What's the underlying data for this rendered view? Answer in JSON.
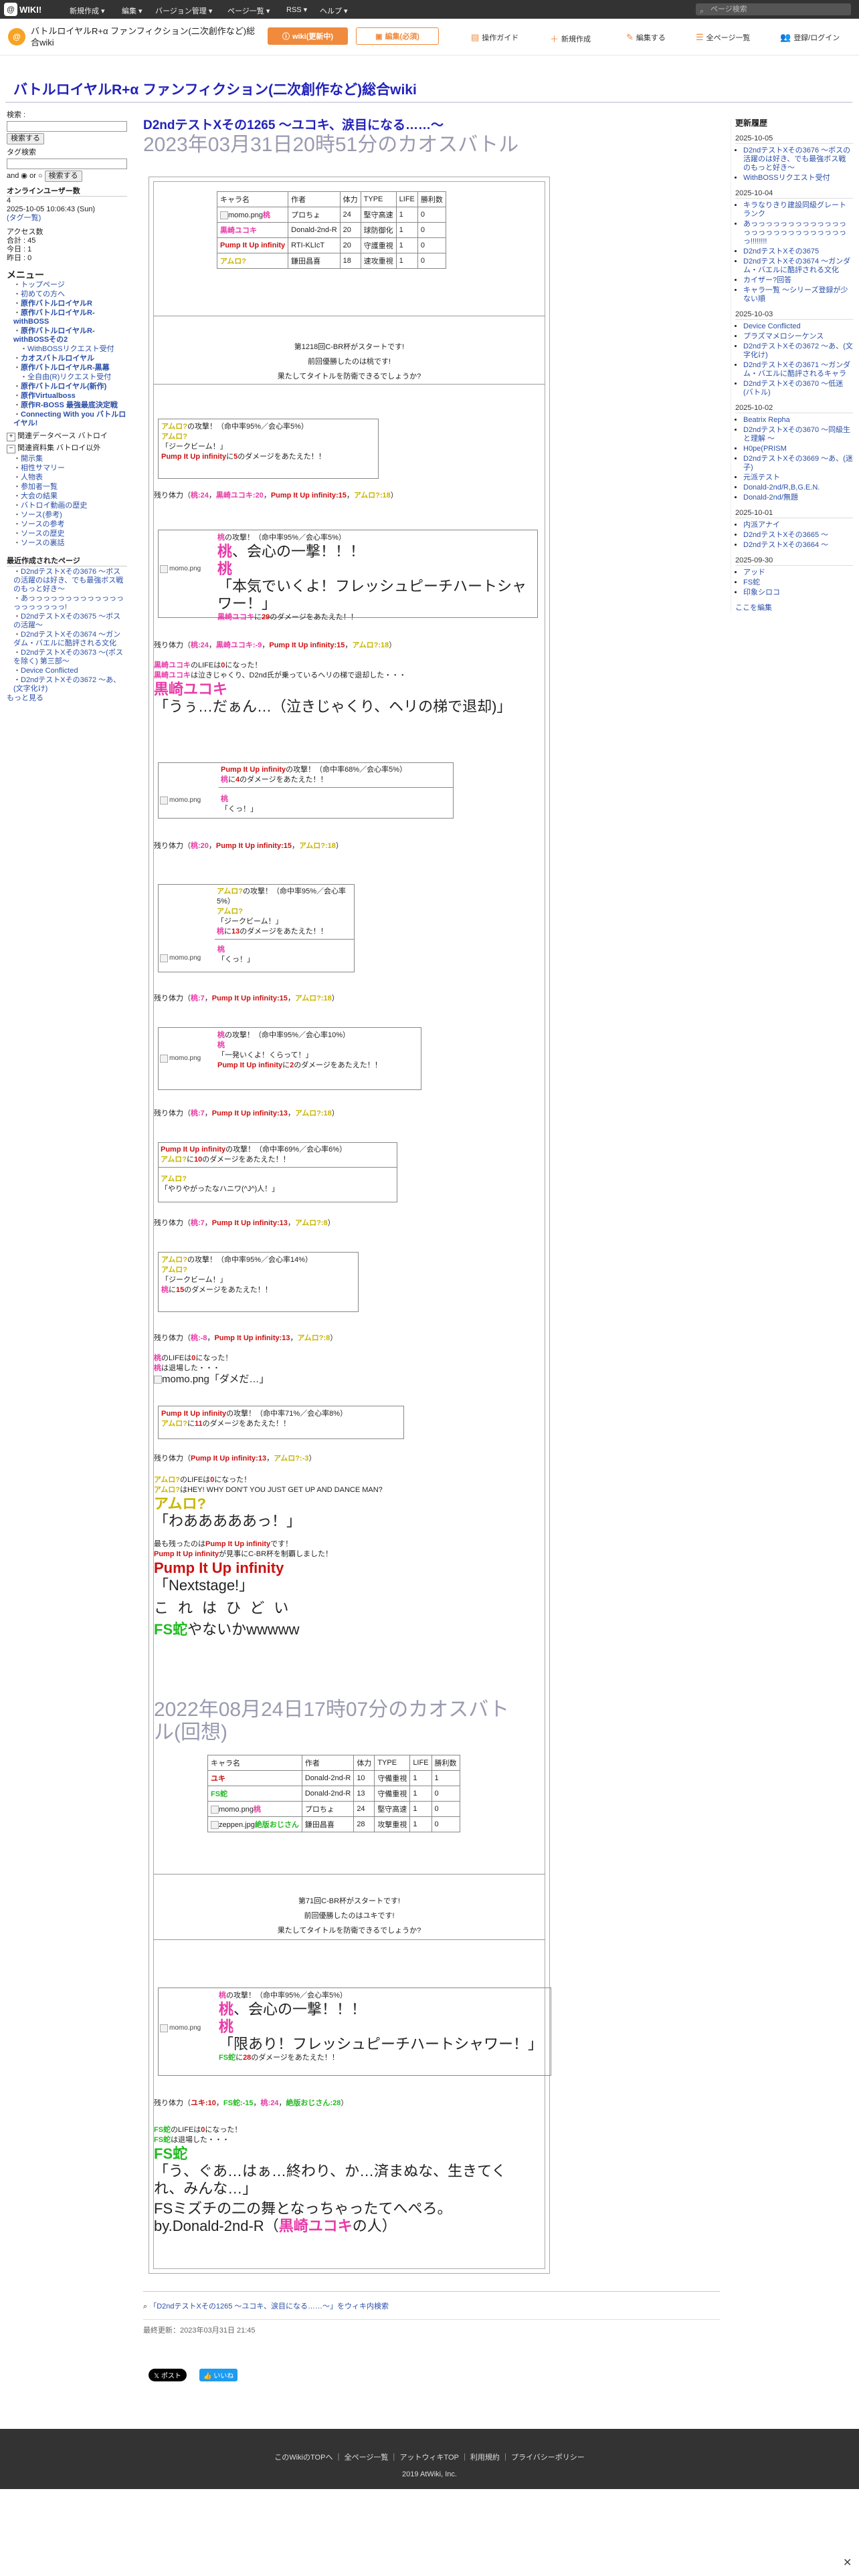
{
  "topbar": {
    "logo": "WIKI!",
    "menus": [
      "新規作成 ▾",
      "編集 ▾",
      "バージョン管理 ▾",
      "ページ一覧 ▾",
      "RSS ▾",
      "ヘルプ ▾"
    ],
    "search_placeholder": "ページ検索"
  },
  "header": {
    "site_name": "バトルロイヤルR+α ファンフィクション(二次創作など)総合wiki",
    "btn_info": "wiki(更新中)",
    "btn_edit_mode": "編集(必須)",
    "links": [
      "操作ガイド",
      "新規作成",
      "編集する",
      "全ページ一覧",
      "登録/ログイン"
    ]
  },
  "wiki_title": "バトルロイヤルR+α ファンフィクション(二次創作など)総合wiki",
  "left": {
    "search_label": "検索 :",
    "search_btn": "検索する",
    "tag_label": "タグ検索",
    "and": "and",
    "or": "or",
    "search_btn2": "検索する",
    "online_title": "オンラインユーザー数",
    "online_count": "4",
    "datetime": "2025-10-05 10:06:43 (Sun)",
    "tag_link": "(タグ一覧)",
    "access_title": "アクセス数",
    "access_total": "合計 : 45",
    "access_today": "今日 : 1",
    "access_yesterday": "昨日 : 0",
    "menu_title": "メニュー",
    "menu_items": [
      {
        "label": "トップページ",
        "bold": false
      },
      {
        "label": "初めての方へ",
        "bold": false
      },
      {
        "label": "原作バトルロイヤルR",
        "bold": true
      },
      {
        "label": "原作バトルロイヤルR-withBOSS",
        "bold": true
      },
      {
        "label": "原作バトルロイヤルR-withBOSSその2",
        "bold": true
      },
      {
        "label": "WithBOSSリクエスト受付",
        "bold": false
      },
      {
        "label": "カオスバトルロイヤル",
        "bold": true
      },
      {
        "label": "原作バトルロイヤルR-黒幕",
        "bold": true
      },
      {
        "label": "全自由(R)リクエスト受付",
        "bold": false
      },
      {
        "label": "原作バトルロイヤル(新作)",
        "bold": true
      },
      {
        "label": "原作Virtualboss",
        "bold": true
      },
      {
        "label": "原作R-BOSS 最強最底決定戦",
        "bold": true
      },
      {
        "label": "Connecting With you バトルロイヤル!",
        "bold": true
      }
    ],
    "toggle1": "関連データベース バトロイ",
    "toggle2": "関連資料集 バトロイ以外",
    "sub_items": [
      "開示集",
      "相性サマリー",
      "人物表",
      "参加者一覧",
      "大会の結果",
      "バトロイ動画の歴史",
      "ソース(参考)",
      "ソースの参考",
      "ソースの歴史",
      "ソースの裏話"
    ],
    "recent_title": "最近作成されたページ",
    "recent": [
      "D2ndテストXその3676 〜ボスの活躍のは好き、でも最強ボス戦のもっと好き〜",
      "あっっっっっっっっっっっっっっっっっっっっ!",
      "D2ndテストXその3675 〜ボスの活躍〜",
      "D2ndテストXその3674 〜ガンダム・バエルに酷評される文化",
      "D2ndテストXその3673 〜(ボスを除く) 第三部〜",
      "Device Conflicted",
      "D2ndテストXその3672 〜あ、(文字化け)"
    ],
    "more": "もっと見る"
  },
  "right": {
    "title": "更新履歴",
    "groups": [
      {
        "date": "2025-10-05",
        "items": [
          "D2ndテストXその3676 〜ボスの活躍のは好き、でも最強ボス戦のもっと好き〜",
          "WithBOSSリクエスト受付"
        ]
      },
      {
        "date": "2025-10-04",
        "items": [
          "キラなりきり建設同級グレートランク",
          "あっっっっっっっっっっっっっっっっっっっっっっっっっっっっ!!!!!!!!",
          "D2ndテストXその3675",
          "D2ndテストXその3674 〜ガンダム・バエルに酷評される文化",
          "カイザー?回答",
          "キャラ一覧 〜シリーズ登録が少ない順"
        ]
      },
      {
        "date": "2025-10-03",
        "items": [
          "Device Conflicted",
          "プラズマメロシーケンス",
          "D2ndテストXその3672 〜あ、(文字化け)",
          "D2ndテストXその3671 〜ガンダム・バエルに酷評されるキャラ",
          "D2ndテストXその3670 〜低迷(バトル)"
        ]
      },
      {
        "date": "2025-10-02",
        "items": [
          "Beatrix Repha",
          "D2ndテストXその3670 〜同級生と理解 〜",
          "H0pe(PRISM",
          "D2ndテストXその3669 〜あ、(迷子)",
          "元派テスト",
          "Donald-2nd/R,B,G.E.N.",
          "Donald-2nd/無題"
        ]
      },
      {
        "date": "2025-10-01",
        "items": [
          "内派アナイ",
          "D2ndテストXその3665 〜",
          "D2ndテストXその3664 〜"
        ]
      },
      {
        "date": "2025-09-30",
        "items": [
          "アッド",
          "FS蛇",
          "印象シロコ"
        ]
      }
    ],
    "more": "ここを編集"
  },
  "main": {
    "title": "D2ndテストXその1265 〜ユコキ、涙目になる……〜",
    "subtitle": "2023年03月31日20時51分のカオスバトル",
    "table1": {
      "headers": [
        "キャラ名",
        "作者",
        "体力",
        "TYPE",
        "LIFE",
        "勝利数"
      ],
      "rows": [
        {
          "img": "momo.png",
          "name": "桃",
          "author": "プロちょ",
          "hp": "24",
          "type": "堅守高速",
          "life": "1",
          "wins": "0"
        },
        {
          "img": "",
          "name": "黒崎ユコキ",
          "author": "Donald-2nd-R",
          "hp": "20",
          "type": "球防御化",
          "life": "1",
          "wins": "0"
        },
        {
          "img": "",
          "name": "Pump It Up infinity",
          "author": "RTI-KLIcT",
          "hp": "20",
          "type": "守護重視",
          "life": "1",
          "wins": "0"
        },
        {
          "img": "",
          "name": "アムロ?",
          "author": "鎌田昌喜",
          "hp": "18",
          "type": "速攻重視",
          "life": "1",
          "wins": "0"
        }
      ]
    },
    "start1a": "第1218回C-BR杯がスタートです!",
    "start1b": "前回優勝したのは桃です!",
    "start1c": "果たしてタイトルを防衛できるでしょうか?",
    "hp_label": "残り体力",
    "sec2_subtitle": "2022年08月24日17時07分のカオスバトル(回想)",
    "table2": {
      "rows": [
        {
          "img": "",
          "name": "ユキ",
          "author": "Donald-2nd-R",
          "hp": "10",
          "type": "守備重視",
          "life": "1",
          "wins": "1"
        },
        {
          "img": "",
          "name": "FS蛇",
          "author": "Donald-2nd-R",
          "hp": "13",
          "type": "守備重視",
          "life": "1",
          "wins": "0"
        },
        {
          "img": "momo.png",
          "name": "桃",
          "author": "プロちょ",
          "hp": "24",
          "type": "堅守高速",
          "life": "1",
          "wins": "0"
        },
        {
          "img": "zeppen.jpg",
          "name": "絶版おじさん",
          "author": "鎌田昌喜",
          "hp": "28",
          "type": "攻撃重視",
          "life": "1",
          "wins": "0"
        }
      ]
    },
    "start2a": "第71回C-BR杯がスタートです!",
    "start2b": "前回優勝したのはユキです!",
    "start2c": "果たしてタイトルを防衛できるでしょうか?",
    "final_line1": "FSミズチの二の舞となっちゃったてへぺろ。",
    "final_line2": "by.Donald-2nd-R",
    "final_name": "黒崎ユコキ",
    "final_suffix": "の人",
    "search_footer": "「D2ndテストXその1265 〜ユコキ、涙目になる……〜」をウィキ内検索",
    "last_updated": "最終更新：2023年03月31日 21:45",
    "share_x": "ポスト",
    "share_like": "いいね"
  },
  "footer": {
    "links": [
      "このWikiのTOPへ",
      "全ページ一覧",
      "アットウィキTOP",
      "利用規約",
      "プライバシーポリシー"
    ],
    "copy": "2019 AtWiki, Inc."
  }
}
